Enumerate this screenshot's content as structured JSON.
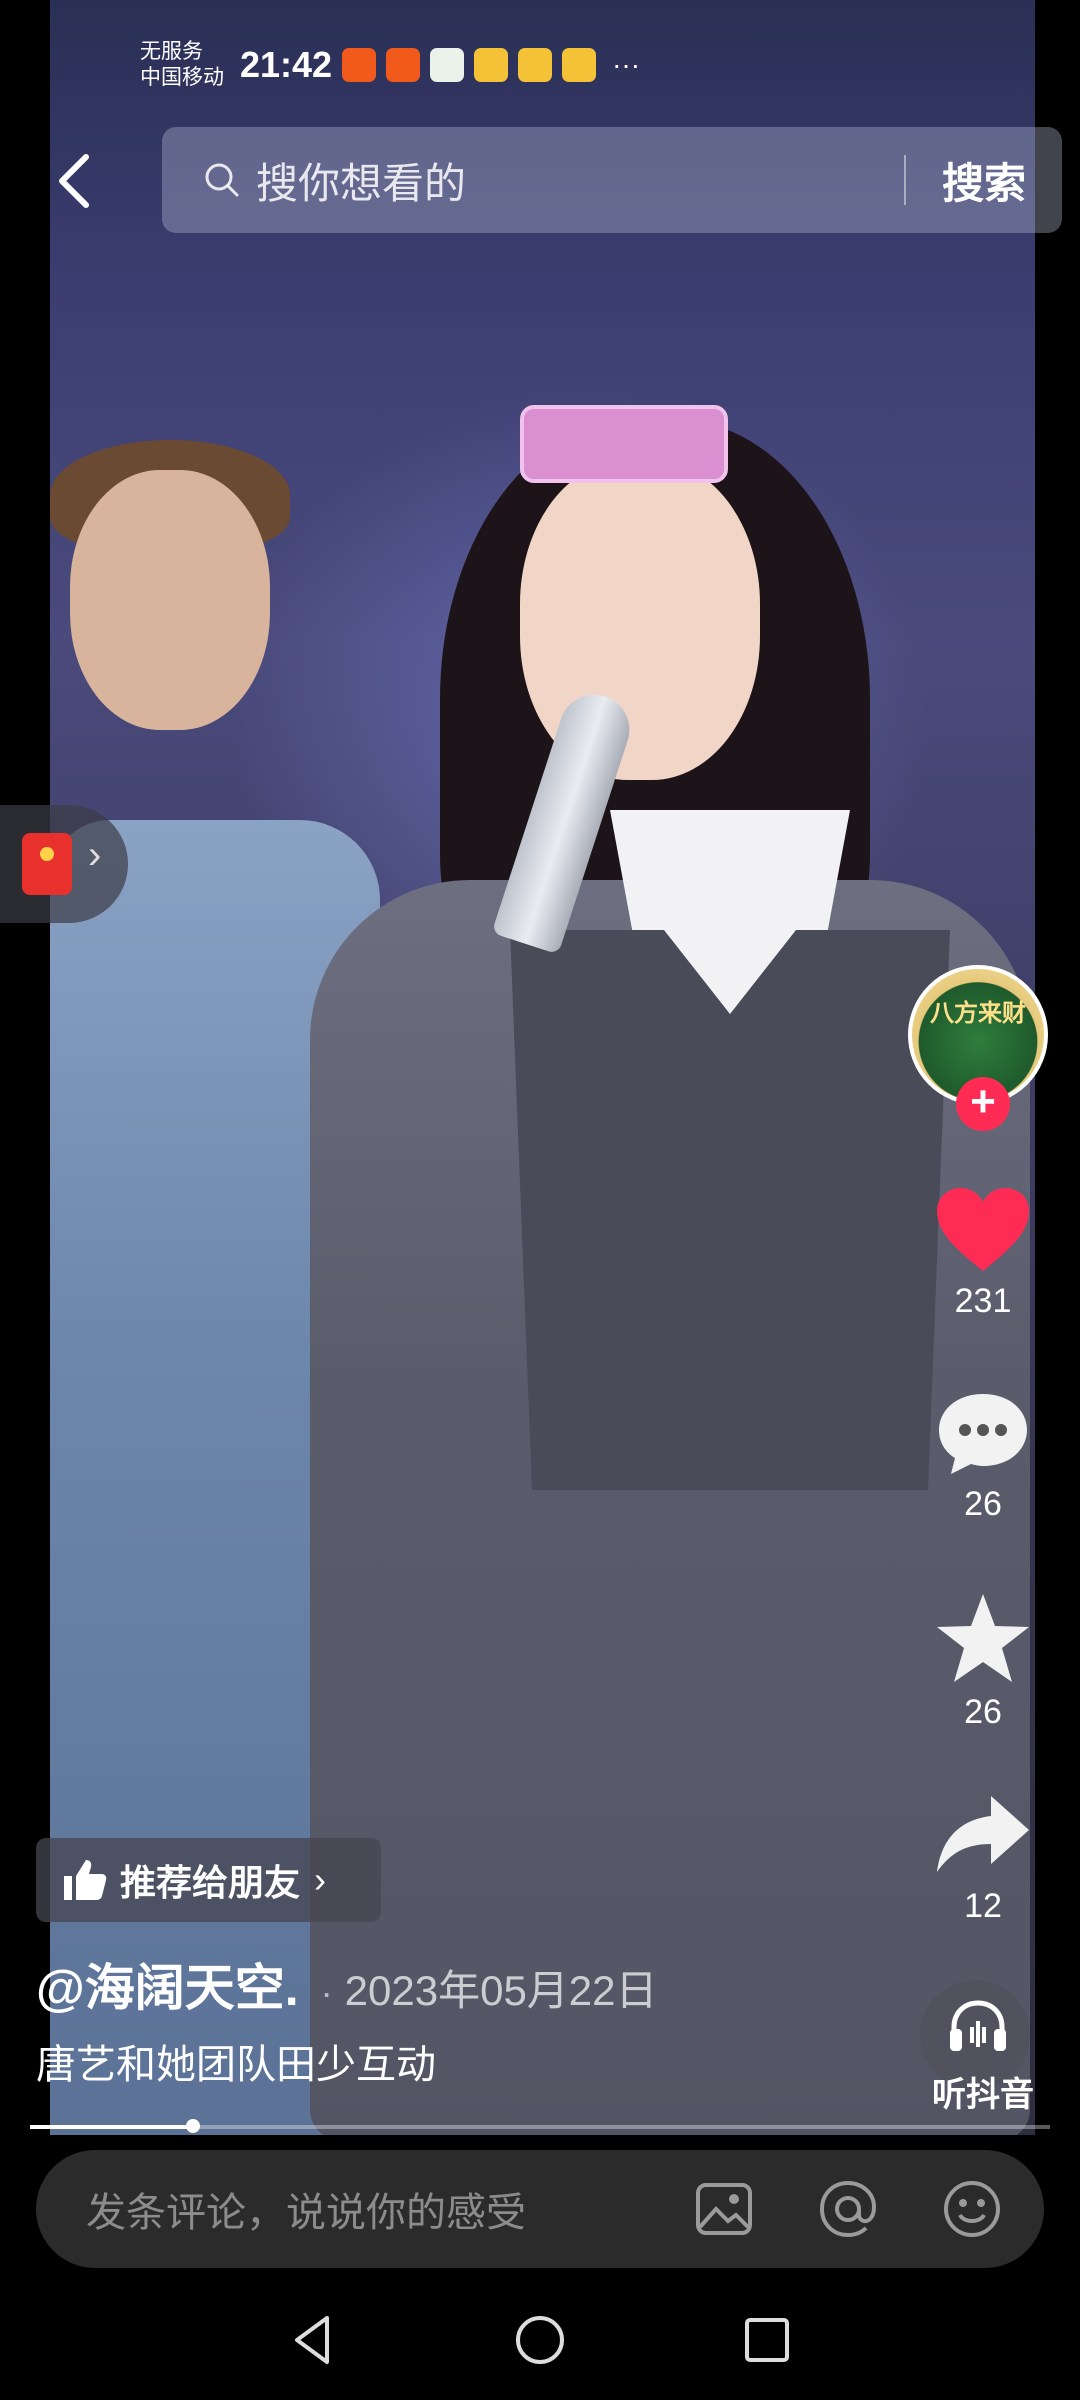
{
  "status_bar": {
    "carrier_line1": "无服务",
    "carrier_line2": "中国移动",
    "time": "21:42",
    "more": "···"
  },
  "search": {
    "placeholder": "搜你想看的",
    "button": "搜索"
  },
  "side_actions": {
    "avatar_text": "八方来财",
    "likes": "231",
    "comments": "26",
    "favorites": "26",
    "shares": "12",
    "listen": "听抖音"
  },
  "video": {
    "recommend": "推荐给朋友",
    "author": "@海阔天空.",
    "date": "2023年05月22日",
    "caption": "唐艺和她团队田少互动",
    "progress": 0.16
  },
  "comment_bar": {
    "placeholder": "发条评论，说说你的感受"
  },
  "colors": {
    "like": "#fe2c55",
    "accent": "#fe2c55",
    "bar_bg": "#2b2b2b"
  }
}
